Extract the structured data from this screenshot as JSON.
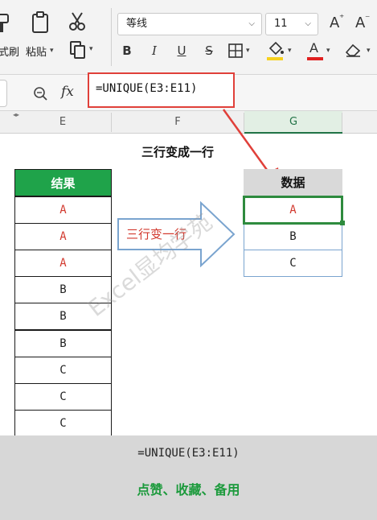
{
  "ribbon": {
    "format_painter_label": "式刷",
    "paste_label": "粘贴",
    "font_name": "等线",
    "font_size": "11",
    "bold": "B",
    "italic": "I",
    "underline": "U",
    "strike": "S",
    "font_color_letter": "A",
    "grow_font": "A",
    "shrink_font": "A",
    "font_color_bar": "#e02020",
    "fill_color_bar": "#f7d11e"
  },
  "formula_bar": {
    "fx": "fx",
    "formula": "=UNIQUE(E3:E11)"
  },
  "columns": [
    "E",
    "F",
    "G"
  ],
  "sheet": {
    "title": "三行变成一行",
    "left_table": {
      "header": "结果",
      "header_color": "#1fa34a",
      "rows": [
        "A",
        "A",
        "A",
        "B",
        "B",
        "B",
        "C",
        "C",
        "C"
      ]
    },
    "arrow_label": "三行变一行",
    "right_table": {
      "header": "数据",
      "header_color": "#d9d9d9",
      "rows": [
        "A",
        "B",
        "C"
      ]
    },
    "watermark": "Excel显均学苑"
  },
  "footer": {
    "formula": "=UNIQUE(E3:E11)",
    "caption": "点赞、收藏、备用",
    "caption_color": "#1c9a3c"
  }
}
